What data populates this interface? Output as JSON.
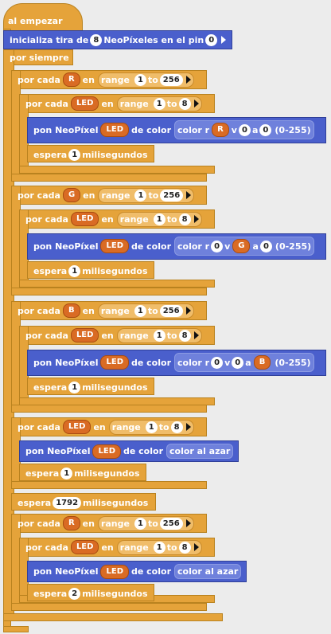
{
  "hat_label": "al empezar",
  "init": {
    "text": "inicializa tira de",
    "count": "8",
    "text2": "NeoPíxeles en el pin",
    "pin": "0"
  },
  "forever_label": "por siempre",
  "for_label": "por cada",
  "en_label": "en",
  "range_label": "range",
  "to_label": "to",
  "pon_label": "pon NeoPíxel",
  "de_color_label": "de color",
  "espera_label": "espera",
  "ms_label": "milisegundos",
  "range_suffix": "(0-255)",
  "color_al_azar": "color al azar",
  "vars": {
    "R": "R",
    "G": "G",
    "B": "B",
    "LED": "LED"
  },
  "nums": {
    "one": "1",
    "eight": "8",
    "max256": "256",
    "zero": "0",
    "two": "2",
    "wait_long": "1792"
  },
  "color_labels": {
    "r": "color r",
    "v": "v",
    "a": "a"
  }
}
